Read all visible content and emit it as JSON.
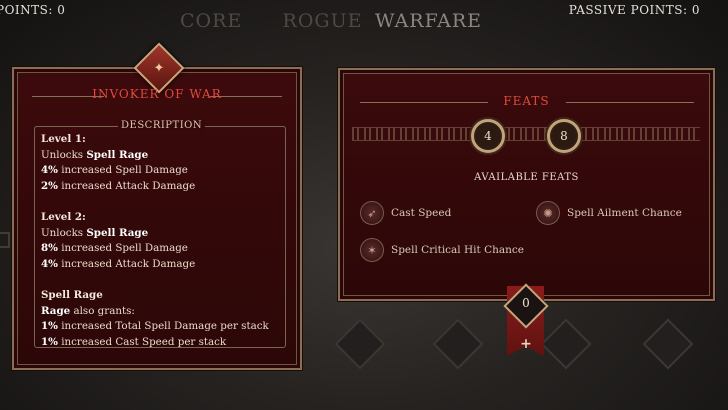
{
  "header": {
    "skill_points": "POINTS: 0",
    "passive_points": "PASSIVE POINTS: 0",
    "tabs": [
      {
        "label": "CORE",
        "active": false
      },
      {
        "label": "ROGUE",
        "active": false
      },
      {
        "label": "WARFARE",
        "active": true
      }
    ]
  },
  "left_panel": {
    "title": "INVOKER OF WAR",
    "description_label": "DESCRIPTION",
    "sections": {
      "level1_heading": "Level 1:",
      "level1_l1_pre": "Unlocks ",
      "level1_l1_bold": "Spell Rage",
      "level1_l2_bold": "4%",
      "level1_l2_rest": " increased Spell Damage",
      "level1_l3_bold": "2%",
      "level1_l3_rest": " increased Attack Damage",
      "level2_heading": "Level 2:",
      "level2_l1_pre": "Unlocks ",
      "level2_l1_bold": "Spell Rage",
      "level2_l2_bold": "8%",
      "level2_l2_rest": " increased Spell Damage",
      "level2_l3_bold": "4%",
      "level2_l3_rest": " increased Attack Damage",
      "rage_heading": "Spell Rage",
      "rage_l1_bold": "Rage",
      "rage_l1_rest": " also grants:",
      "rage_l2_bold": "1%",
      "rage_l2_rest": " increased Total Spell Damage per stack",
      "rage_l3_bold": "1%",
      "rage_l3_rest": " increased Cast Speed per stack"
    }
  },
  "right_panel": {
    "title": "FEATS",
    "count_a": "4",
    "count_b": "8",
    "available_label": "AVAILABLE FEATS",
    "feats": [
      {
        "label": "Cast Speed",
        "icon": "cast-speed-icon"
      },
      {
        "label": "Spell Ailment Chance",
        "icon": "spell-ailment-icon"
      },
      {
        "label": "Spell Critical Hit Chance",
        "icon": "spell-crit-icon"
      }
    ]
  },
  "badge": {
    "value": "0",
    "plus": "+"
  },
  "colors": {
    "panel_red": "#330809",
    "title_red": "#e04a3c",
    "gold_border": "#8a6f57"
  }
}
